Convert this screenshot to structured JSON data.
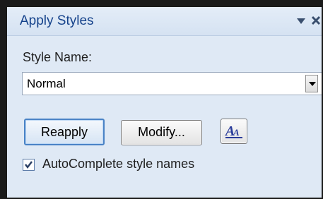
{
  "panel": {
    "title": "Apply Styles",
    "menu_icon": "dropdown-arrow-icon",
    "close_icon": "close-icon"
  },
  "style_name": {
    "label": "Style Name:",
    "value": "Normal",
    "dropdown_icon": "chevron-down-icon"
  },
  "buttons": {
    "reapply": "Reapply",
    "modify": "Modify...",
    "styles_icon": "styles-a-icon"
  },
  "autocomplete": {
    "label": "AutoComplete style names",
    "checked": true
  },
  "colors": {
    "title_text": "#15428b",
    "panel_bg": "#dfe9f5",
    "focus_border": "#4a83c6"
  }
}
